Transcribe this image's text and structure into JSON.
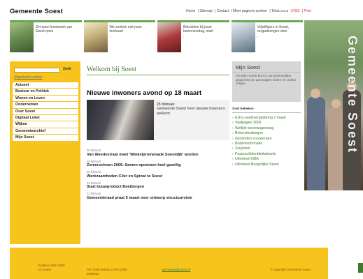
{
  "header": {
    "logo": "Gemeente Soest",
    "nav": [
      "Home",
      "| Sitemap",
      "| Contact",
      "| Meer pagina's zoeken",
      "| Tekst a a a",
      "| RSS",
      "| Print"
    ]
  },
  "promos": [
    {
      "text": "Zet jouw feestweek van Soest open",
      "link": "›"
    },
    {
      "text": "We zoeken ook jouw leerbuurt",
      "link": "›"
    },
    {
      "text": "Betrokken bij jouw bewonersdag, start",
      "link": "›"
    },
    {
      "text": "Vrijwilligers in Soest, vergaderingen door",
      "link": "›"
    }
  ],
  "side_photo": {
    "vertical_title": "Gemeente Soest"
  },
  "left_nav": {
    "search_button": "Zoek",
    "advanced_link": "Uitgebreid zoeken",
    "menu": [
      "Actueel",
      "Bestuur en Politiek",
      "Wonen en Leven",
      "Ondernemen",
      "Over Soest",
      "Digitaal Loket",
      "Wijken",
      "Gemeentearchief",
      "Mijn Soest"
    ]
  },
  "content": {
    "welcome": "Welkom bij Soest",
    "headline": "Nieuwe inwoners avond op 18 maart",
    "feature": {
      "date": "25 februari",
      "text": "Gemeente Soest heet nieuwe inwoners welkom"
    },
    "news": [
      {
        "date": "25 februari",
        "title": "Van Weedestraat meet 'Winkelpromenade Soestdijk' worden"
      },
      {
        "date": "25 februari",
        "title": "Zomerschoon 2009: Samen opruimen heel gezellig"
      },
      {
        "date": "25 februari",
        "title": "Werkzaamheden Ciler en Spinat te Soest"
      },
      {
        "date": "23 februari",
        "title": "Start bouwproduct Beetbergen"
      },
      {
        "date": "23 februari",
        "title": "Gemeenteraad praat 5 maart over ontwerp structuurvisie"
      }
    ]
  },
  "right_col": {
    "mijn_title": "Mijn Soest",
    "mijn_text": "Via Mijn Soest kunt u uw persoonlijke gegevens en aanvragen inzien en online volgen.",
    "quick_head": "Snel bekeken",
    "quick_links": [
      "Extra raadsvergadering 2 maart",
      "Vaalpagen 2009",
      "Wetlijst woonwagenwag",
      "Bekendmakingen",
      "Gevonden voorwerpen",
      "Bodeminformatie",
      "Zorgloket",
      "Paspoort/identiteitsbewijs",
      "Uittreksel GBA",
      "Uittreksel Burgerlijke Stand"
    ]
  },
  "footer": {
    "col1": "Postbus 2000 3760 CA Soest",
    "col2": "Tel. (035) 6093411 Fax (035) 6093333",
    "col3": "gemeente@soest.nl",
    "col4": "© copyright Gemeente Soest"
  },
  "colors": {
    "brand_yellow": "#f7c31d",
    "brand_green": "#3d7b2b",
    "accent_green": "#6aa84f"
  }
}
